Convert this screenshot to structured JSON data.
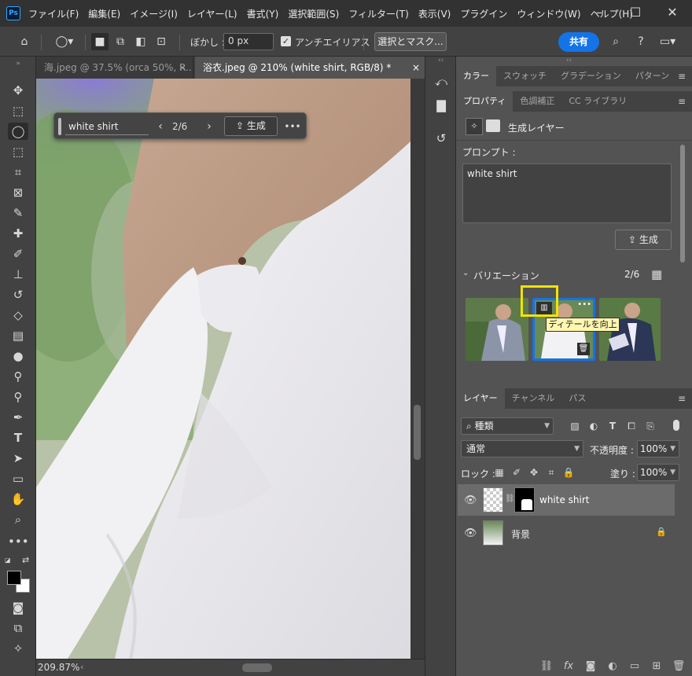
{
  "app": {
    "logo": "Ps"
  },
  "menu": [
    "ファイル(F)",
    "編集(E)",
    "イメージ(I)",
    "レイヤー(L)",
    "書式(Y)",
    "選択範囲(S)",
    "フィルター(T)",
    "表示(V)",
    "プラグイン",
    "ウィンドウ(W)",
    "ヘルプ(H)"
  ],
  "window_controls": {
    "minimize": "–",
    "maximize": "☐",
    "close": "✕"
  },
  "options": {
    "feather_label": "ぼかし :",
    "feather_value": "0 px",
    "antialias_label": "アンチエイリアス",
    "antialias_checked": "✓",
    "select_mask": "選択とマスク...",
    "share": "共有"
  },
  "tabs": [
    {
      "label": "海.jpeg @ 37.5% (orca 50%, R..."
    },
    {
      "label": "浴衣.jpeg @ 210% (white shirt, RGB/8) *"
    }
  ],
  "contextual_taskbar": {
    "prompt": "white shirt",
    "count": "2/6",
    "generate": "生成"
  },
  "status": {
    "zoom": "209.87%"
  },
  "panel_tabs_top": [
    "カラー",
    "スウォッチ",
    "グラデーション",
    "パターン"
  ],
  "panel_tabs_mid": [
    "プロパティ",
    "色調補正",
    "CC ライブラリ"
  ],
  "properties": {
    "layer_type": "生成レイヤー",
    "prompt_label": "プロンプト :",
    "prompt_value": "white shirt",
    "generate": "生成",
    "variations_label": "バリエーション",
    "variations_count": "2/6",
    "tooltip": "ディテールを向上"
  },
  "layers_tabs": [
    "レイヤー",
    "チャンネル",
    "パス"
  ],
  "layers": {
    "filter_kind": "種類",
    "blend_mode": "通常",
    "opacity_label": "不透明度 :",
    "opacity_value": "100%",
    "lock_label": "ロック :",
    "fill_label": "塗り :",
    "fill_value": "100%",
    "items": [
      {
        "name": "white shirt"
      },
      {
        "name": "背景"
      }
    ]
  },
  "colors": {
    "accent": "#1473e6",
    "highlight": "#f2e300",
    "tooltip_bg": "#fff6b0"
  }
}
